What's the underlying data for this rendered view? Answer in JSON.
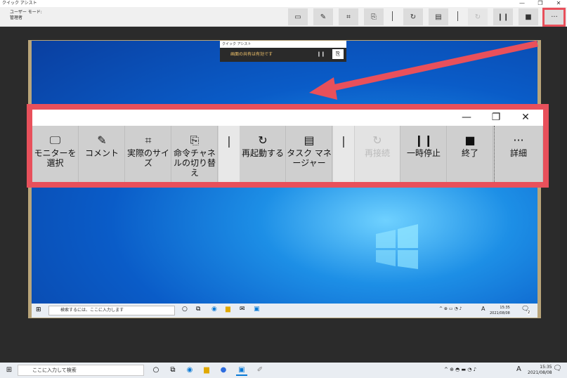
{
  "app": {
    "title": "クイック アシスト",
    "mode_label": "ユーザー モード:",
    "mode_value": "管理者"
  },
  "window_controls": {
    "minimize": "—",
    "maximize": "❐",
    "close": "✕"
  },
  "toolbar": {
    "more": "···"
  },
  "remote": {
    "mini_title": "クイック アシスト",
    "mini_status": "画面の共有は有効です",
    "search_placeholder": "検索するには、ここに入力します",
    "ime": "A",
    "time": "15:35",
    "date": "2021/08/08",
    "notify_count": "2"
  },
  "magnified": {
    "buttons": [
      {
        "icon": "monitor-select-icon",
        "label": "モニターを選択"
      },
      {
        "icon": "annotate-icon",
        "label": "コメント"
      },
      {
        "icon": "actual-size-icon",
        "label": "実際のサイズ"
      },
      {
        "icon": "toggle-instruction-channel-icon",
        "label": "命令チャネルの切り替え"
      },
      {
        "icon": "restart-icon",
        "label": "再起動する"
      },
      {
        "icon": "task-manager-icon",
        "label": "タスク マネージャー"
      },
      {
        "icon": "reconnect-icon",
        "label": "再接続"
      },
      {
        "icon": "pause-icon",
        "label": "一時停止"
      },
      {
        "icon": "stop-icon",
        "label": "終了"
      },
      {
        "icon": "more-icon",
        "label": "詳細"
      }
    ]
  },
  "taskbar": {
    "search_placeholder": "ここに入力して検索",
    "ime": "A",
    "time": "15:35",
    "date": "2021/08/08"
  },
  "colors": {
    "highlight": "#e8505b",
    "accent": "#0a5cc8"
  }
}
